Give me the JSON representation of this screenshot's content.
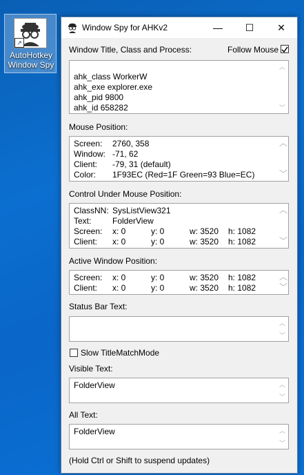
{
  "desktop": {
    "icon_label_line1": "AutoHotkey",
    "icon_label_line2": "Window Spy",
    "icon": "spy-icon"
  },
  "window": {
    "title": "Window Spy for AHKv2",
    "minimize": "—",
    "maximize": "☐",
    "close": "✕",
    "sections": {
      "title_label": "Window Title, Class and Process:",
      "follow_mouse_label": "Follow Mouse",
      "follow_mouse_checked": true,
      "title_lines": [
        "ahk_class WorkerW",
        "ahk_exe explorer.exe",
        "ahk_pid 9800",
        "ahk_id 658282"
      ],
      "mouse_label": "Mouse Position:",
      "mouse": {
        "screen_label": "Screen:",
        "screen_value": "2760, 358",
        "window_label": "Window:",
        "window_value": "-71, 62",
        "client_label": "Client:",
        "client_value": "-79, 31 (default)",
        "color_label": "Color:",
        "color_value": "1F93EC (Red=1F Green=93 Blue=EC)"
      },
      "control_label": "Control Under Mouse Position:",
      "control": {
        "classnn_label": "ClassNN:",
        "classnn_value": "SysListView321",
        "text_label": "Text:",
        "text_value": "FolderView",
        "screen_label": "Screen:",
        "screen_x": "x: 0",
        "screen_y": "y: 0",
        "screen_w": "w: 3520",
        "screen_h": "h: 1082",
        "client_label": "Client:",
        "client_x": "x: 0",
        "client_y": "y: 0",
        "client_w": "w: 3520",
        "client_h": "h: 1082"
      },
      "active_label": "Active Window Position:",
      "active": {
        "screen_label": "Screen:",
        "screen_x": "x: 0",
        "screen_y": "y: 0",
        "screen_w": "w: 3520",
        "screen_h": "h: 1082",
        "client_label": "Client:",
        "client_x": "x: 0",
        "client_y": "y: 0",
        "client_w": "w: 3520",
        "client_h": "h: 1082"
      },
      "status_label": "Status Bar Text:",
      "status_text": "",
      "slow_label": "Slow TitleMatchMode",
      "slow_checked": false,
      "visible_label": "Visible Text:",
      "visible_text": "FolderView",
      "all_label": "All Text:",
      "all_text": "FolderView",
      "footer": "(Hold Ctrl or Shift to suspend updates)"
    }
  }
}
